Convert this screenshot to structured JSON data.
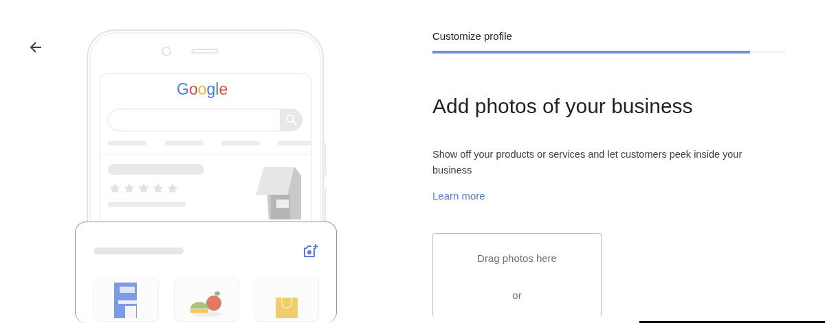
{
  "illustration": {
    "logo": "Google"
  },
  "progress": {
    "label": "Customize profile",
    "level": 0.9
  },
  "heading": "Add photos of your business",
  "description": "Show off your products or services and let customers peek inside your business",
  "link": "Learn more",
  "dropzone": {
    "title": "Drag photos here",
    "separator": "or"
  }
}
